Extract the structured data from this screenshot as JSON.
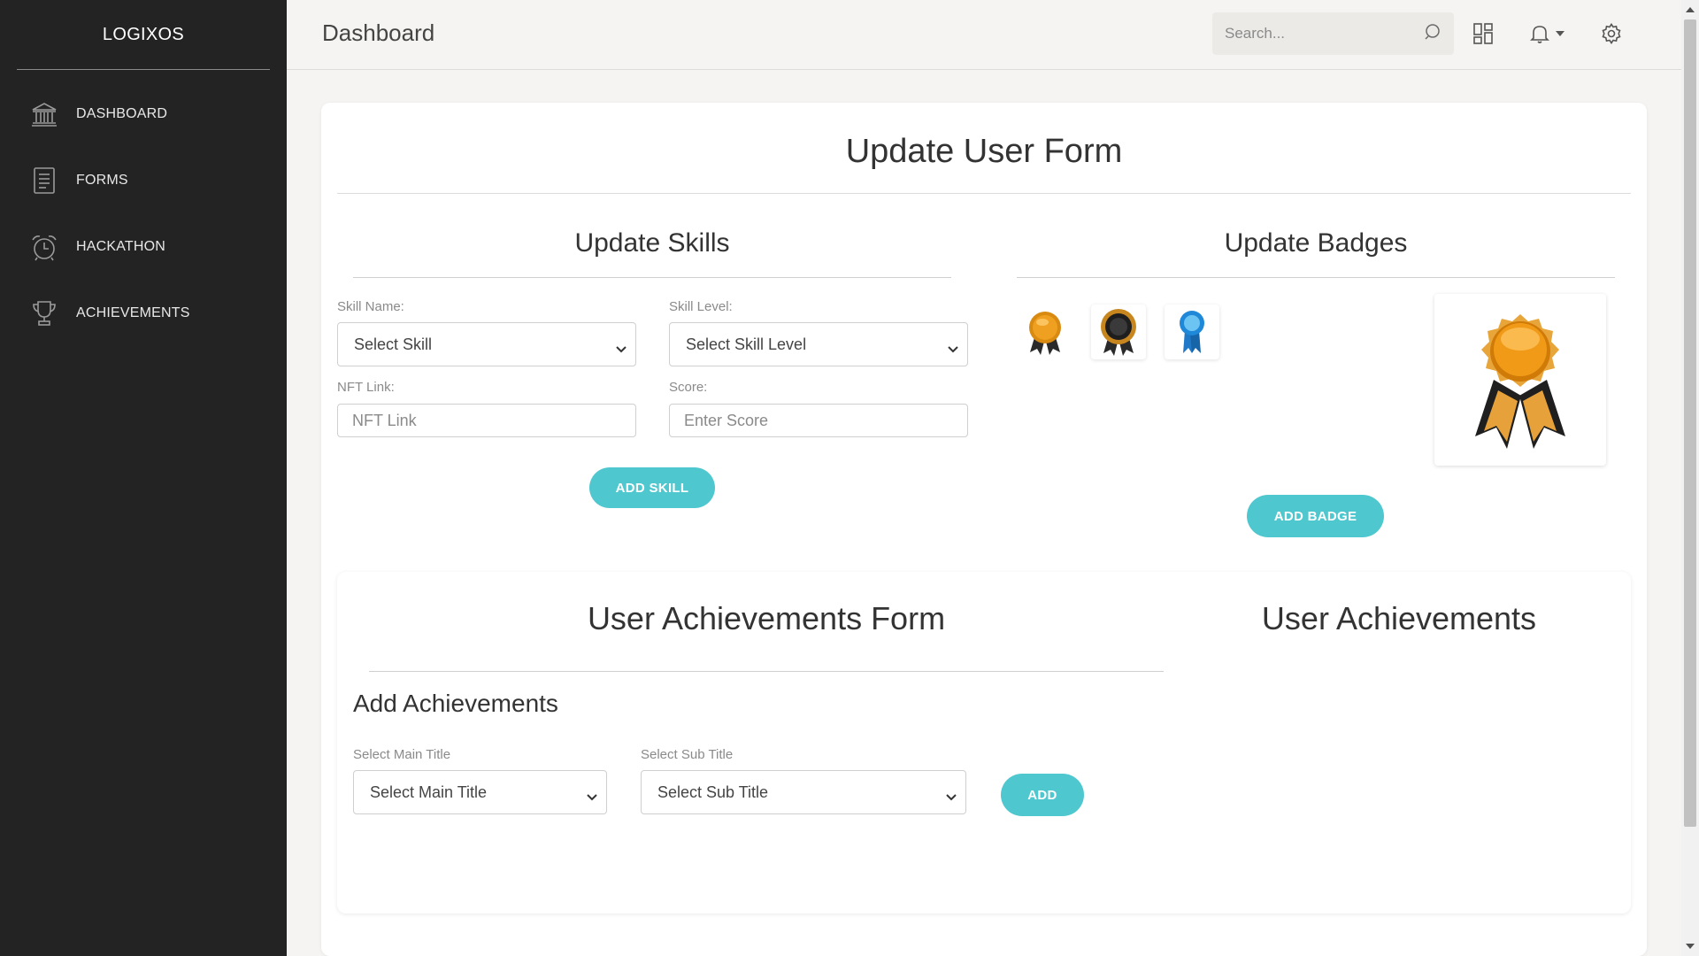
{
  "sidebar": {
    "brand": "LOGIXOS",
    "items": [
      {
        "label": "DASHBOARD",
        "icon": "bank-icon"
      },
      {
        "label": "FORMS",
        "icon": "document-icon"
      },
      {
        "label": "HACKATHON",
        "icon": "alarm-clock-icon"
      },
      {
        "label": "ACHIEVEMENTS",
        "icon": "trophy-icon"
      }
    ]
  },
  "header": {
    "title": "Dashboard",
    "search_placeholder": "Search...",
    "icons": [
      "search-icon",
      "grid-icon",
      "bell-icon",
      "caret-down-icon",
      "gear-icon"
    ]
  },
  "form": {
    "title": "Update User Form",
    "skills": {
      "title": "Update Skills",
      "skill_name_label": "Skill Name:",
      "skill_name_value": "Select Skill",
      "skill_level_label": "Skill Level:",
      "skill_level_value": "Select Skill Level",
      "nft_label": "NFT Link:",
      "nft_placeholder": "NFT Link",
      "score_label": "Score:",
      "score_placeholder": "Enter Score",
      "add_button": "ADD SKILL"
    },
    "badges": {
      "title": "Update Badges",
      "options": [
        "gold-medal-badge",
        "black-rosette-badge",
        "blue-ribbon-badge"
      ],
      "selected": "gold-rosette-badge",
      "add_button": "ADD BADGE"
    }
  },
  "achievements": {
    "form_title": "User Achievements Form",
    "list_title": "User Achievements",
    "sub_heading": "Add Achievements",
    "main_title_label": "Select Main Title",
    "main_title_value": "Select Main Title",
    "sub_title_label": "Select Sub Title",
    "sub_title_value": "Select Sub Title",
    "add_button": "ADD"
  },
  "colors": {
    "sidebar_bg": "#232323",
    "accent": "#4fc7cf",
    "page_bg": "#f5f4f2"
  }
}
